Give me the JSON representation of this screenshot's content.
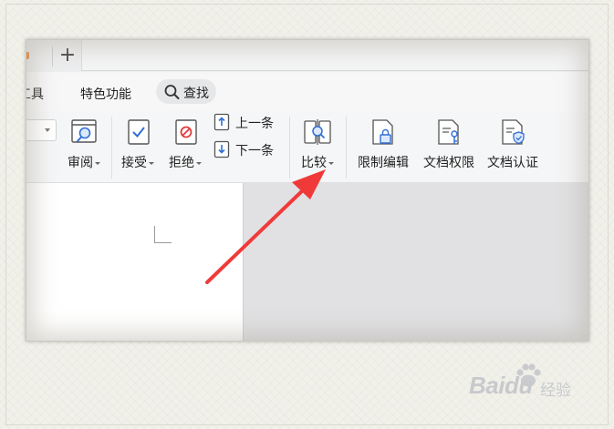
{
  "tabbar": {
    "new_tab_symbol": "+"
  },
  "menu": {
    "items": [
      "工具",
      "特色功能"
    ],
    "search_label": "查找"
  },
  "ribbon": {
    "review_label": "审阅",
    "accept_label": "接受",
    "reject_label": "拒绝",
    "prev_label": "上一条",
    "next_label": "下一条",
    "compare_label": "比较",
    "restrict_edit_label": "限制编辑",
    "doc_permission_label": "文档权限",
    "doc_auth_label": "文档认证"
  },
  "watermark": {
    "brand": "Baidu",
    "suffix": "经验"
  },
  "colors": {
    "arrow": "#f03a3a",
    "icon_blue": "#2f6fd6",
    "icon_red": "#e23b3b",
    "tab_accent": "#f0883a"
  }
}
